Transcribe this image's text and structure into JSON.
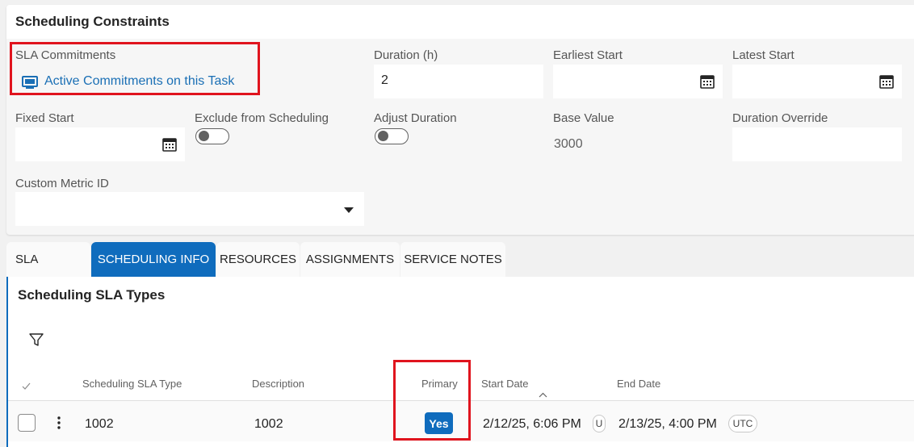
{
  "card": {
    "title": "Scheduling Constraints",
    "sla_commitments": {
      "label": "SLA Commitments",
      "link_text": "Active Commitments on this Task"
    },
    "duration": {
      "label": "Duration (h)",
      "value": "2"
    },
    "earliest_start": {
      "label": "Earliest Start",
      "value": ""
    },
    "latest_start": {
      "label": "Latest Start",
      "value": ""
    },
    "fixed_start": {
      "label": "Fixed Start",
      "value": ""
    },
    "exclude_from_scheduling": {
      "label": "Exclude from Scheduling",
      "on": false
    },
    "adjust_duration": {
      "label": "Adjust Duration",
      "on": false
    },
    "base_value": {
      "label": "Base Value",
      "value": "3000"
    },
    "duration_override": {
      "label": "Duration Override",
      "value": ""
    },
    "custom_metric_id": {
      "label": "Custom Metric ID",
      "value": ""
    }
  },
  "tabs": [
    {
      "label": "SLA",
      "active": false
    },
    {
      "label": "SCHEDULING INFO",
      "active": true
    },
    {
      "label": "RESOURCES",
      "active": false
    },
    {
      "label": "ASSIGNMENTS",
      "active": false
    },
    {
      "label": "SERVICE NOTES",
      "active": false
    }
  ],
  "grid": {
    "title": "Scheduling SLA Types",
    "columns": {
      "type": "Scheduling SLA Type",
      "description": "Description",
      "primary": "Primary",
      "start_date": "Start Date",
      "end_date": "End Date"
    },
    "rows": [
      {
        "type": "1002",
        "description": "1002",
        "primary": "Yes",
        "start_date": "2/12/25, 6:06 PM",
        "start_tz": "U",
        "end_date": "2/13/25, 4:00 PM",
        "end_tz": "UTC"
      }
    ]
  },
  "icons": {
    "commitments": "monitor-icon",
    "calendar": "calendar-icon",
    "filter": "filter-icon",
    "dropdown": "chevron-down-icon",
    "more": "more-vertical-icon",
    "sort": "sort-ascending-icon"
  },
  "colors": {
    "accent": "#0f6cbd",
    "link": "#1a6fb5",
    "highlight": "#e0141e"
  }
}
